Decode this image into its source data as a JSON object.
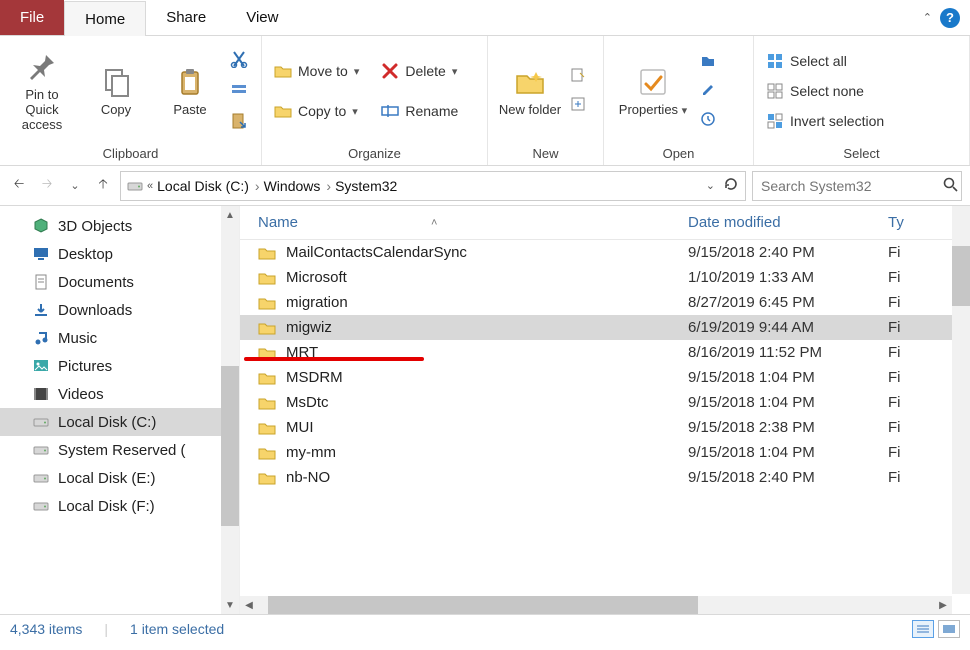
{
  "tabs": {
    "file": "File",
    "home": "Home",
    "share": "Share",
    "view": "View"
  },
  "titlebar": {
    "help": "?"
  },
  "ribbon": {
    "clipboard": {
      "label": "Clipboard",
      "pin": "Pin to Quick access",
      "copy": "Copy",
      "paste": "Paste"
    },
    "organize": {
      "label": "Organize",
      "move_to": "Move to",
      "copy_to": "Copy to",
      "delete": "Delete",
      "rename": "Rename"
    },
    "new": {
      "label": "New",
      "new_folder": "New folder"
    },
    "open": {
      "label": "Open",
      "properties": "Properties"
    },
    "select": {
      "label": "Select",
      "select_all": "Select all",
      "select_none": "Select none",
      "invert": "Invert selection"
    }
  },
  "breadcrumb": {
    "parts": [
      "Local Disk (C:)",
      "Windows",
      "System32"
    ]
  },
  "search": {
    "placeholder": "Search System32"
  },
  "columns": {
    "name": "Name",
    "date": "Date modified",
    "type": "Ty"
  },
  "sidebar": [
    {
      "label": "3D Objects",
      "icon": "3d",
      "selected": false
    },
    {
      "label": "Desktop",
      "icon": "desktop",
      "selected": false
    },
    {
      "label": "Documents",
      "icon": "documents",
      "selected": false
    },
    {
      "label": "Downloads",
      "icon": "downloads",
      "selected": false
    },
    {
      "label": "Music",
      "icon": "music",
      "selected": false
    },
    {
      "label": "Pictures",
      "icon": "pictures",
      "selected": false
    },
    {
      "label": "Videos",
      "icon": "videos",
      "selected": false
    },
    {
      "label": "Local Disk (C:)",
      "icon": "disk",
      "selected": true
    },
    {
      "label": "System Reserved (",
      "icon": "disk",
      "selected": false
    },
    {
      "label": "Local Disk (E:)",
      "icon": "disk",
      "selected": false
    },
    {
      "label": "Local Disk (F:)",
      "icon": "disk",
      "selected": false
    }
  ],
  "rows": [
    {
      "name": "MailContactsCalendarSync",
      "date": "9/15/2018 2:40 PM",
      "type": "Fi",
      "selected": false
    },
    {
      "name": "Microsoft",
      "date": "1/10/2019 1:33 AM",
      "type": "Fi",
      "selected": false
    },
    {
      "name": "migration",
      "date": "8/27/2019 6:45 PM",
      "type": "Fi",
      "selected": false
    },
    {
      "name": "migwiz",
      "date": "6/19/2019 9:44 AM",
      "type": "Fi",
      "selected": true
    },
    {
      "name": "MRT",
      "date": "8/16/2019 11:52 PM",
      "type": "Fi",
      "selected": false
    },
    {
      "name": "MSDRM",
      "date": "9/15/2018 1:04 PM",
      "type": "Fi",
      "selected": false
    },
    {
      "name": "MsDtc",
      "date": "9/15/2018 1:04 PM",
      "type": "Fi",
      "selected": false
    },
    {
      "name": "MUI",
      "date": "9/15/2018 2:38 PM",
      "type": "Fi",
      "selected": false
    },
    {
      "name": "my-mm",
      "date": "9/15/2018 1:04 PM",
      "type": "Fi",
      "selected": false
    },
    {
      "name": "nb-NO",
      "date": "9/15/2018 2:40 PM",
      "type": "Fi",
      "selected": false
    }
  ],
  "status": {
    "items": "4,343 items",
    "selected": "1 item selected"
  },
  "annotation": {
    "underline_target": "migwiz"
  }
}
